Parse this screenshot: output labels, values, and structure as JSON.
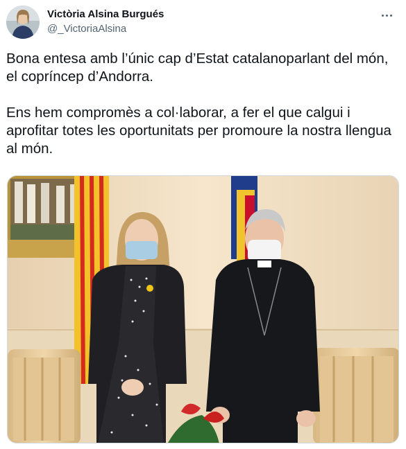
{
  "author": {
    "display_name": "Victòria Alsina Burgués",
    "handle": "@_VictoriaAlsina",
    "avatar_icon": "profile-photo"
  },
  "menu": {
    "icon": "more-dots-icon"
  },
  "tweet": {
    "paragraphs": [
      "Bona entesa amb l’únic cap d’Estat catalanoparlant del món, el copríncep d’Andorra.",
      "Ens hem compromès a col·laborar, a fer el que calgui i aprofitar totes les oportunitats per promoure la nostra llengua al món."
    ]
  },
  "media": {
    "description_icon": "photo-two-people-with-flags"
  },
  "colors": {
    "text": "#0f1419",
    "secondary_text": "#536471",
    "border": "#cfd9de"
  }
}
